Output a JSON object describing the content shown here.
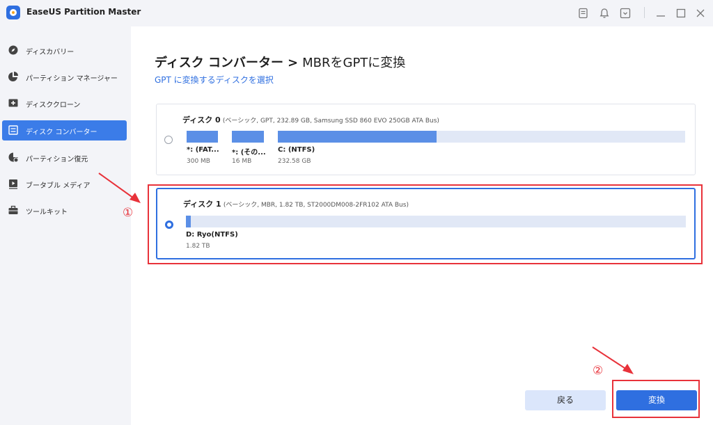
{
  "app": {
    "title": "EaseUS Partition Master"
  },
  "titlebar": {
    "icons": [
      "notes-icon",
      "bell-icon",
      "dropdown-icon",
      "minimize-icon",
      "maximize-icon",
      "close-icon"
    ]
  },
  "sidebar": {
    "items": [
      {
        "label": "ディスカバリー",
        "icon": "compass-icon",
        "active": false
      },
      {
        "label": "パーティション マネージャー",
        "icon": "pie-chart-icon",
        "active": false
      },
      {
        "label": "ディスククローン",
        "icon": "clone-icon",
        "active": false
      },
      {
        "label": "ディスク コンバーター",
        "icon": "disk-convert-icon",
        "active": true
      },
      {
        "label": "パーティション復元",
        "icon": "partition-recovery-icon",
        "active": false
      },
      {
        "label": "ブータブル メディア",
        "icon": "bootable-media-icon",
        "active": false
      },
      {
        "label": "ツールキット",
        "icon": "toolbox-icon",
        "active": false
      }
    ]
  },
  "main": {
    "title_main": "ディスク コンバーター",
    "title_sep": ">",
    "title_sub": "MBRをGPTに変換",
    "subtitle": "GPT に変換するディスクを選択",
    "disks": [
      {
        "name": "ディスク 0",
        "detail": "(ベーシック, GPT, 232.89 GB, Samsung SSD 860 EVO 250GB ATA Bus)",
        "selected": false,
        "partitions": [
          {
            "label": "*: (FAT...",
            "size": "300 MB",
            "used": 1.0
          },
          {
            "label": "*: (その...",
            "size": "16 MB",
            "used": 1.0
          },
          {
            "label": "C: (NTFS)",
            "size": "232.58 GB",
            "used": 0.39
          }
        ]
      },
      {
        "name": "ディスク 1",
        "detail": "(ベーシック, MBR, 1.82 TB, ST2000DM008-2FR102 ATA Bus)",
        "selected": true,
        "partitions": [
          {
            "label": "D: Ryo(NTFS)",
            "size": "1.82 TB",
            "used": 0.01
          }
        ]
      }
    ],
    "buttons": {
      "back": "戻る",
      "convert": "変換"
    }
  },
  "annotations": {
    "step1": "①",
    "step2": "②",
    "color": "#e8323a"
  },
  "colors": {
    "accent": "#2f6fe0",
    "partition_fill": "#5b8fe6",
    "partition_track": "#e1e8f6"
  }
}
